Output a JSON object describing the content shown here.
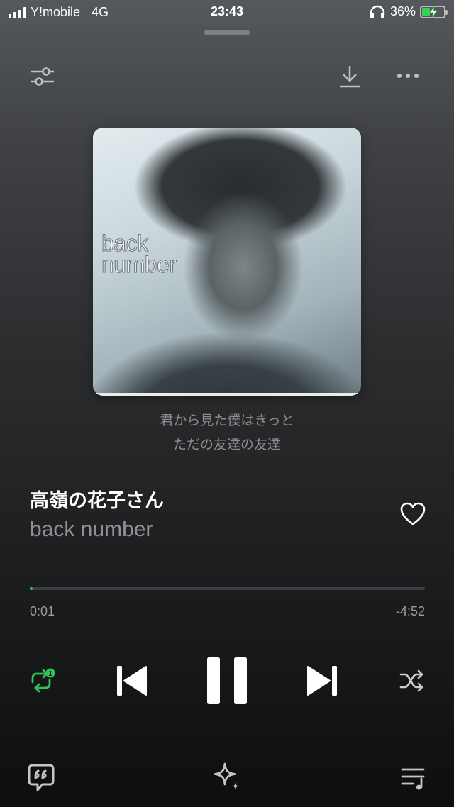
{
  "status_bar": {
    "carrier": "Y!mobile",
    "network": "4G",
    "time": "23:43",
    "battery_percent": "36%",
    "battery_level": 0.36,
    "charging": true
  },
  "album": {
    "cover_text_line1": "back",
    "cover_text_line2": "number"
  },
  "lyrics": {
    "line1": "君から見た僕はきっと",
    "line2": "ただの友達の友達"
  },
  "track": {
    "title": "高嶺の花子さん",
    "artist": "back number",
    "liked": false
  },
  "playback": {
    "elapsed": "0:01",
    "remaining": "-4:52",
    "progress_fraction": 0.004,
    "state": "playing",
    "repeat_mode": "repeat-one",
    "repeat_badge": "1",
    "shuffle": false
  },
  "colors": {
    "accent": "#2fc25b",
    "text_primary": "#ffffff",
    "text_secondary": "#8f9194"
  },
  "icons": {
    "equalizer": "equalizer-icon",
    "download": "download-icon",
    "more": "more-icon",
    "like": "heart-outline-icon",
    "repeat": "repeat-one-icon",
    "previous": "previous-track-icon",
    "pause": "pause-icon",
    "next": "next-track-icon",
    "shuffle": "shuffle-icon",
    "lyrics": "lyrics-icon",
    "sparkle": "sparkle-icon",
    "queue": "queue-icon"
  }
}
